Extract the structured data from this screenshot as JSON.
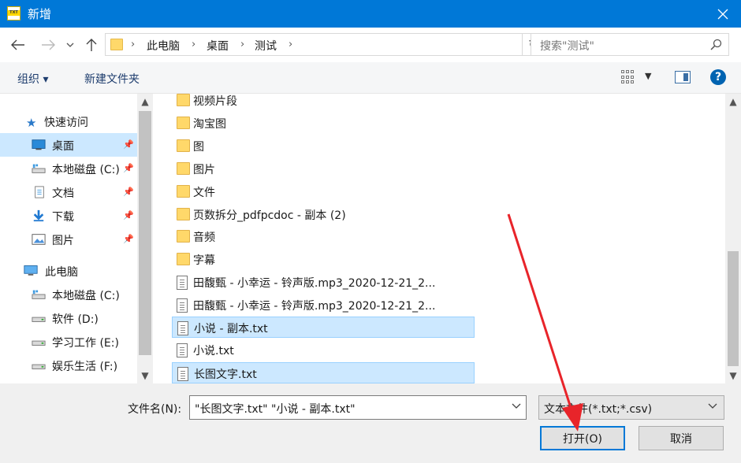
{
  "window": {
    "title": "新增"
  },
  "address": {
    "crumbs": [
      "此电脑",
      "桌面",
      "测试"
    ]
  },
  "search": {
    "placeholder": "搜索\"测试\""
  },
  "toolbar": {
    "organize": "组织 ▾",
    "new_folder": "新建文件夹"
  },
  "sidebar": {
    "items": [
      {
        "label": "快速访问",
        "icon": "star-icon"
      },
      {
        "label": "桌面",
        "icon": "desktop-icon",
        "pinned": true,
        "selected": true
      },
      {
        "label": "本地磁盘 (C:)",
        "icon": "drive-icon",
        "pinned": true
      },
      {
        "label": "文档",
        "icon": "document-icon",
        "pinned": true
      },
      {
        "label": "下载",
        "icon": "download-icon",
        "pinned": true
      },
      {
        "label": "图片",
        "icon": "picture-icon",
        "pinned": true
      },
      {
        "label": "此电脑",
        "icon": "computer-icon"
      },
      {
        "label": "本地磁盘 (C:)",
        "icon": "drive-icon"
      },
      {
        "label": "软件 (D:)",
        "icon": "drive-icon"
      },
      {
        "label": "学习工作 (E:)",
        "icon": "drive-icon"
      },
      {
        "label": "娱乐生活 (F:)",
        "icon": "drive-icon"
      }
    ]
  },
  "files": [
    {
      "name": "视频片段",
      "type": "folder"
    },
    {
      "name": "淘宝图",
      "type": "folder"
    },
    {
      "name": "图",
      "type": "folder"
    },
    {
      "name": "图片",
      "type": "folder"
    },
    {
      "name": "文件",
      "type": "folder"
    },
    {
      "name": "页数拆分_pdfpcdoc - 副本 (2)",
      "type": "folder"
    },
    {
      "name": "音频",
      "type": "folder"
    },
    {
      "name": "字幕",
      "type": "folder"
    },
    {
      "name": "田馥甄 - 小幸运 - 铃声版.mp3_2020-12-21_2...",
      "type": "file"
    },
    {
      "name": "田馥甄 - 小幸运 - 铃声版.mp3_2020-12-21_2...",
      "type": "file"
    },
    {
      "name": "小说 - 副本.txt",
      "type": "file",
      "selected": true
    },
    {
      "name": "小说.txt",
      "type": "file"
    },
    {
      "name": "长图文字.txt",
      "type": "file",
      "selected": true
    }
  ],
  "bottom": {
    "filename_label": "文件名(N):",
    "filename_value": "\"长图文字.txt\" \"小说 - 副本.txt\"",
    "filetype_value": "文本文件(*.txt;*.csv)",
    "open_label": "打开(O)",
    "cancel_label": "取消"
  },
  "colors": {
    "titlebar": "#0078d7",
    "selection": "#cce8ff",
    "annotation": "#e8242a"
  }
}
